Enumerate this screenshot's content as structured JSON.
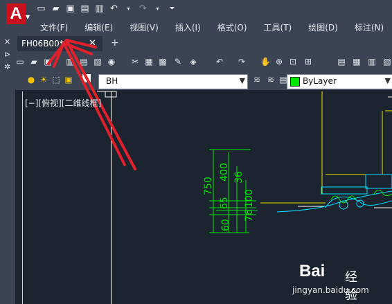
{
  "app": {
    "logo_letter": "A"
  },
  "menu": [
    "文件(F)",
    "编辑(E)",
    "视图(V)",
    "插入(I)",
    "格式(O)",
    "工具(T)",
    "绘图(D)",
    "标注(N)"
  ],
  "tab": {
    "name": "FH06B00*",
    "close": "✕",
    "new": "+"
  },
  "layer": {
    "name": "BH"
  },
  "color": {
    "name": "ByLayer",
    "swatch": "#00e600"
  },
  "viewport_label": "[−][俯视][二维线框]",
  "dims": {
    "vertical_left": [
      "750",
      "400",
      "65",
      "60"
    ],
    "vertical_right": [
      "36",
      "100",
      "76"
    ]
  },
  "watermark": {
    "brand": "Bai",
    "cn": "经验",
    "url": "jingyan.baidu.com"
  },
  "colors": {
    "annotation": "#e0202a",
    "dimension": "#00e600",
    "drawing_cyan": "#00e0ff",
    "drawing_yellow": "#f2e600"
  }
}
